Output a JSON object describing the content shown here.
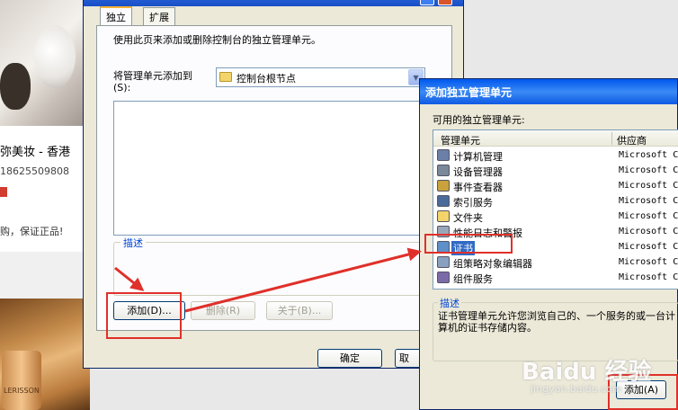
{
  "background_page": {
    "title": "弥美妆 - 香港",
    "phone": "18625509808",
    "desc": "购，保证正品!",
    "brand": "LERISSON"
  },
  "main_dialog": {
    "tabs": [
      "独立",
      "扩展"
    ],
    "intro": "使用此页来添加或删除控制台的独立管理单元。",
    "add_to_label": "将管理单元添加到(S):",
    "combo_value": "控制台根节点",
    "desc_legend": "描述",
    "buttons": {
      "add": "添加(D)...",
      "remove": "删除(R)",
      "about": "关于(B)..."
    },
    "ok": "确定",
    "cancel": "取"
  },
  "add_dialog": {
    "title": "添加独立管理单元",
    "available_label": "可用的独立管理单元:",
    "columns": [
      "管理单元",
      "供应商"
    ],
    "rows": [
      {
        "name": "计算机管理",
        "vendor": "Microsoft C",
        "icon": "computer-management-icon",
        "selected": false
      },
      {
        "name": "设备管理器",
        "vendor": "Microsoft C",
        "icon": "device-manager-icon",
        "selected": false
      },
      {
        "name": "事件查看器",
        "vendor": "Microsoft C",
        "icon": "event-viewer-icon",
        "selected": false
      },
      {
        "name": "索引服务",
        "vendor": "Microsoft C",
        "icon": "indexing-service-icon",
        "selected": false
      },
      {
        "name": "文件夹",
        "vendor": "Microsoft C",
        "icon": "folder-icon",
        "selected": false
      },
      {
        "name": "性能日志和警报",
        "vendor": "Microsoft C",
        "icon": "performance-logs-icon",
        "selected": false
      },
      {
        "name": "证书",
        "vendor": "Microsoft C",
        "icon": "certificates-icon",
        "selected": true
      },
      {
        "name": "组策略对象编辑器",
        "vendor": "Microsoft C",
        "icon": "group-policy-icon",
        "selected": false
      },
      {
        "name": "组件服务",
        "vendor": "Microsoft C",
        "icon": "component-services-icon",
        "selected": false
      }
    ],
    "desc_legend": "描述",
    "description": "证书管理单元允许您浏览自己的、一个服务的或一台计算机的证书存储内容。",
    "add_button": "添加(A)"
  },
  "watermark": {
    "text": "Baidu 经验",
    "sub": "jingyan.baidu.com"
  },
  "colors": {
    "highlight": "#e0302a",
    "xp_blue": "#0058ee",
    "selection": "#316ac5"
  }
}
